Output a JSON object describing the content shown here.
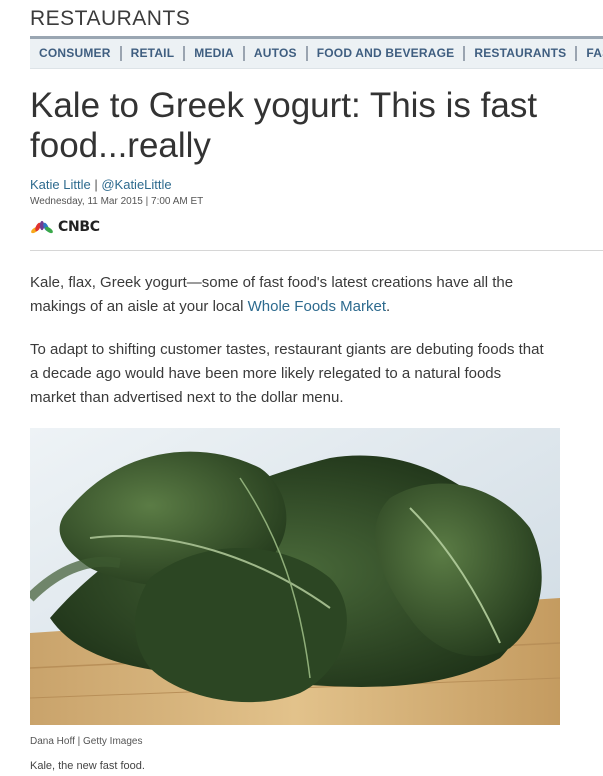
{
  "section": {
    "title": "RESTAURANTS"
  },
  "nav": {
    "items": [
      "CONSUMER",
      "RETAIL",
      "MEDIA",
      "AUTOS",
      "FOOD AND BEVERAGE",
      "RESTAURANTS",
      "FASHION"
    ]
  },
  "article": {
    "headline": "Kale to Greek yogurt: This is fast food...really",
    "author": "Katie Little",
    "byline_separator": "|",
    "handle": "@KatieLittle",
    "date": "Wednesday, 11 Mar 2015 | 7:00 AM ET",
    "source_logo": "CNBC",
    "paragraph1_text": "Kale, flax, Greek yogurt—some of fast food's latest creations have all the makings of an aisle at your local ",
    "paragraph1_link": "Whole Foods Market",
    "paragraph1_end": ".",
    "paragraph2": "To adapt to shifting customer tastes, restaurant giants are debuting foods that a decade ago would have been more likely relegated to a natural foods market than advertised next to the dollar menu.",
    "photo_credit": "Dana Hoff | Getty Images",
    "photo_caption": "Kale, the new fast food."
  },
  "colors": {
    "link": "#2d6a8e",
    "nav_text": "#3f5e80",
    "nav_bg": "#ecf1f4"
  },
  "icons": {
    "logo": "peacock-logo-icon"
  }
}
